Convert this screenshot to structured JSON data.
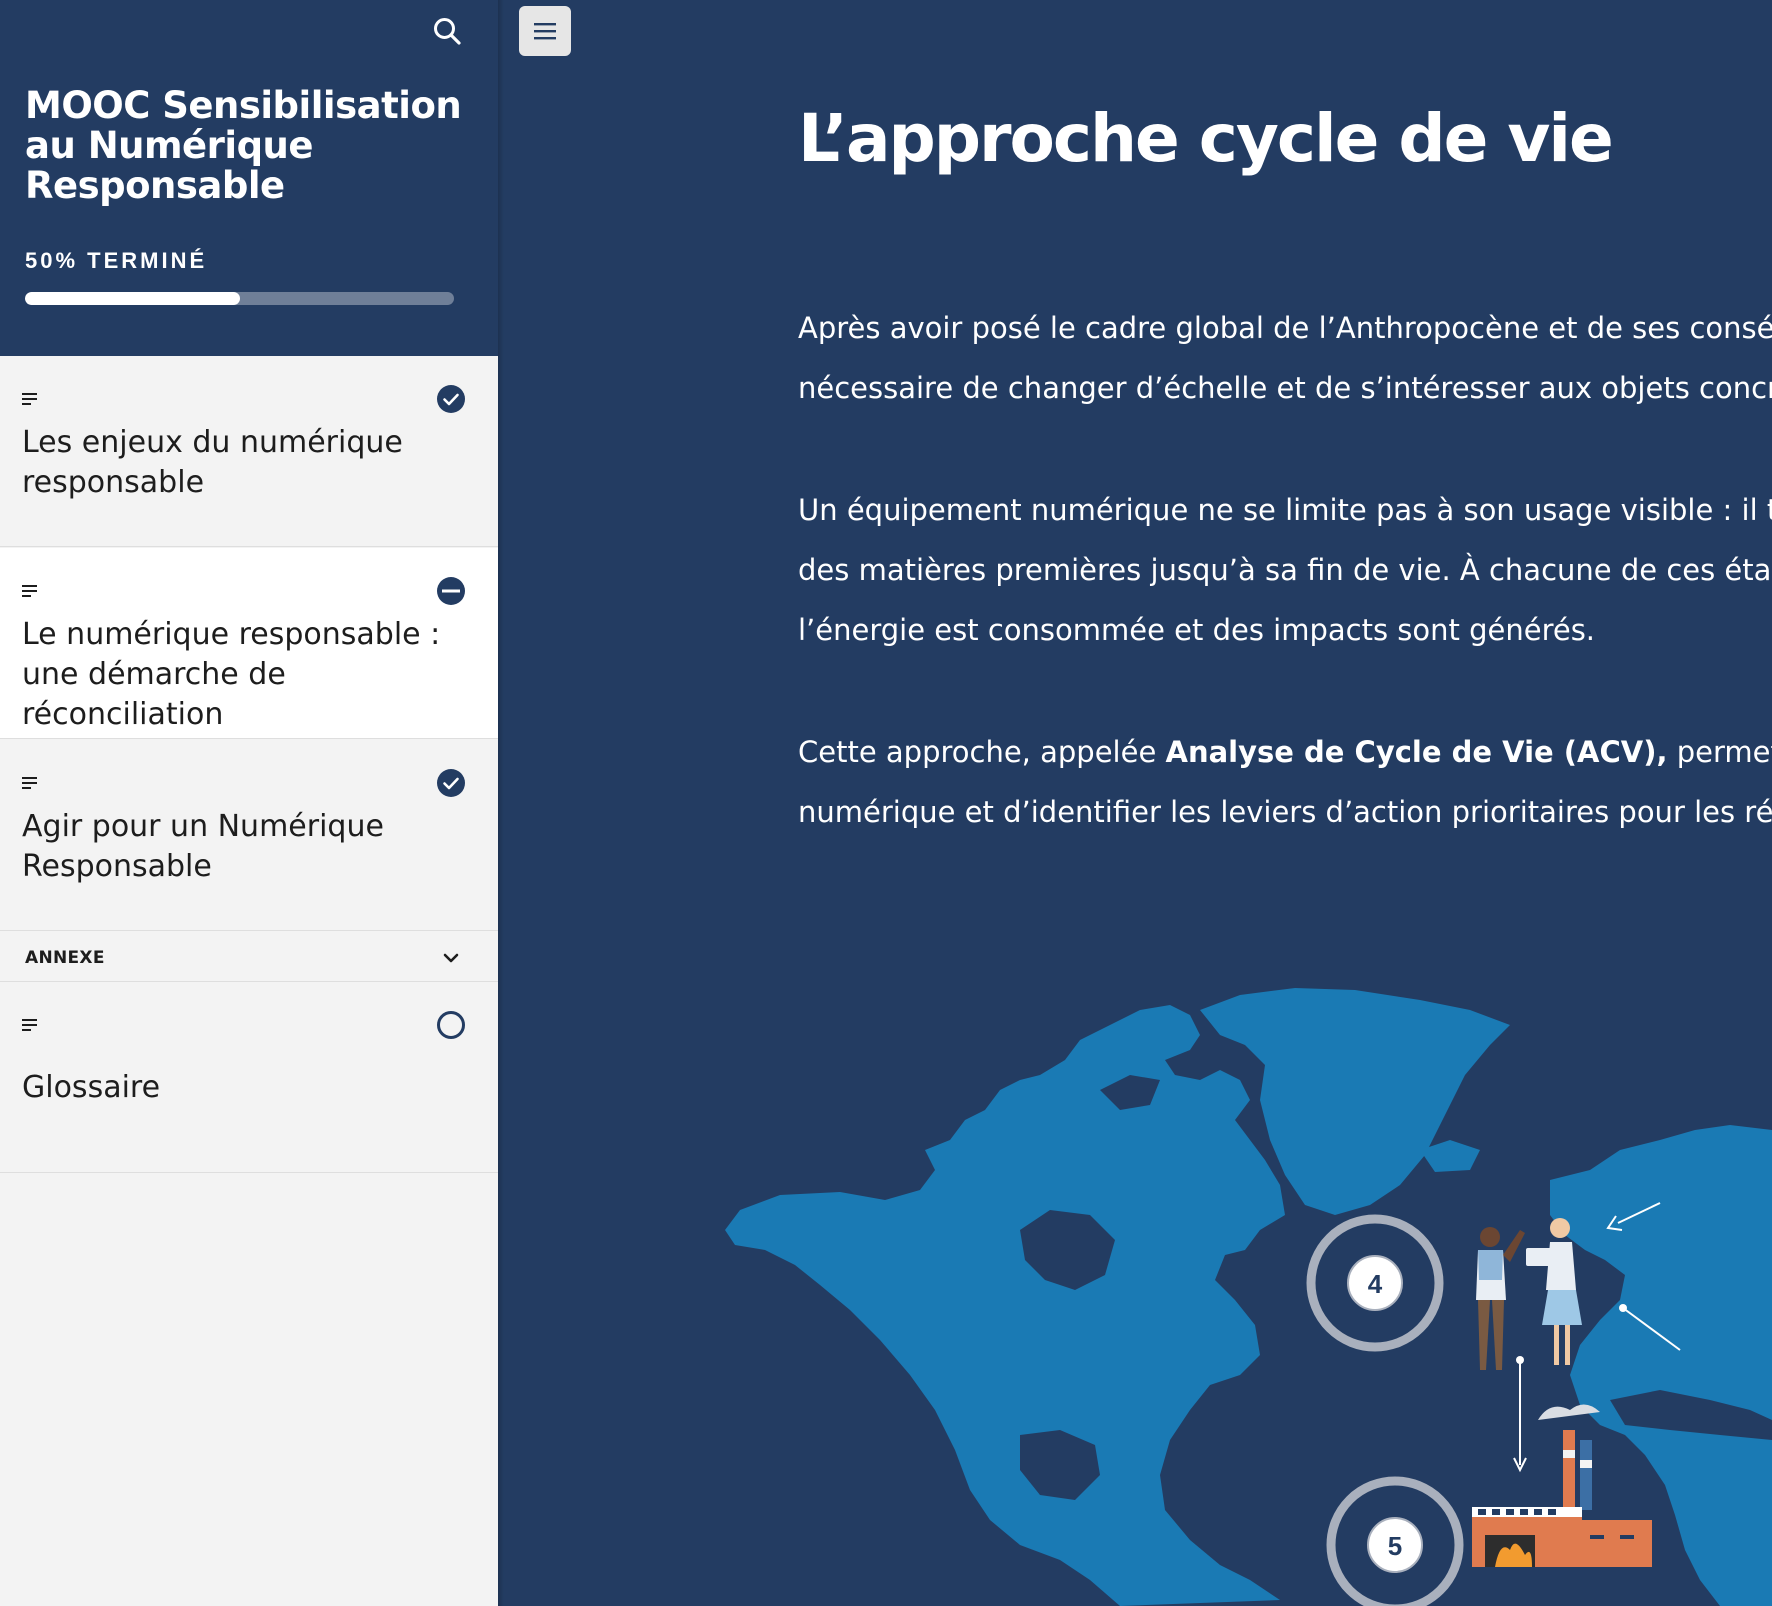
{
  "sidebar": {
    "course_title": "MOOC Sensibilisation au Numérique Responsable",
    "progress": {
      "label": "50% TERMINÉ",
      "percent": 50
    },
    "lessons": [
      {
        "title": "Les enjeux du numérique responsable",
        "status": "completed"
      },
      {
        "title": "Le numérique responsable : une démarche de réconciliation",
        "status": "in-progress"
      },
      {
        "title": "Agir pour un Numérique Responsable",
        "status": "completed"
      }
    ],
    "section": {
      "label": "ANNEXE",
      "lessons": [
        {
          "title": "Glossaire",
          "status": "not-started"
        }
      ]
    }
  },
  "main": {
    "title": "L’approche cycle de vie",
    "paragraphs": [
      {
        "line1": "Après avoir posé le cadre global de l’Anthropocène et de ses consé",
        "line2": "nécessaire de changer d’échelle et de s’intéresser aux objets concre"
      },
      {
        "line1": "Un équipement numérique ne se limite pas à son usage visible : il tr",
        "line2": "des matières premières jusqu’à sa fin de vie. À chacune de ces étap",
        "line3": "l’énergie est consommée et des impacts sont générés."
      },
      {
        "line1_prefix": "Cette approche, appelée ",
        "line1_bold": "Analyse de Cycle de Vie (ACV),",
        "line1_suffix": " permet d’",
        "line2": "numérique et d’identifier les leviers d’action prioritaires pour les rédu"
      }
    ],
    "illustration": {
      "steps": [
        "4",
        "5"
      ]
    }
  },
  "colors": {
    "navy": "#233c62",
    "map_land": "#1a7ab4",
    "sidebar_bg": "#f3f3f3",
    "factory": "#e07b4f"
  },
  "icons": {
    "search": "search-icon",
    "menu": "hamburger-menu-icon",
    "lesson_type": "text-lines-icon",
    "completed": "check-circle-icon",
    "in_progress": "half-circle-icon",
    "not_started": "empty-circle-icon",
    "chevron": "chevron-down-icon"
  }
}
